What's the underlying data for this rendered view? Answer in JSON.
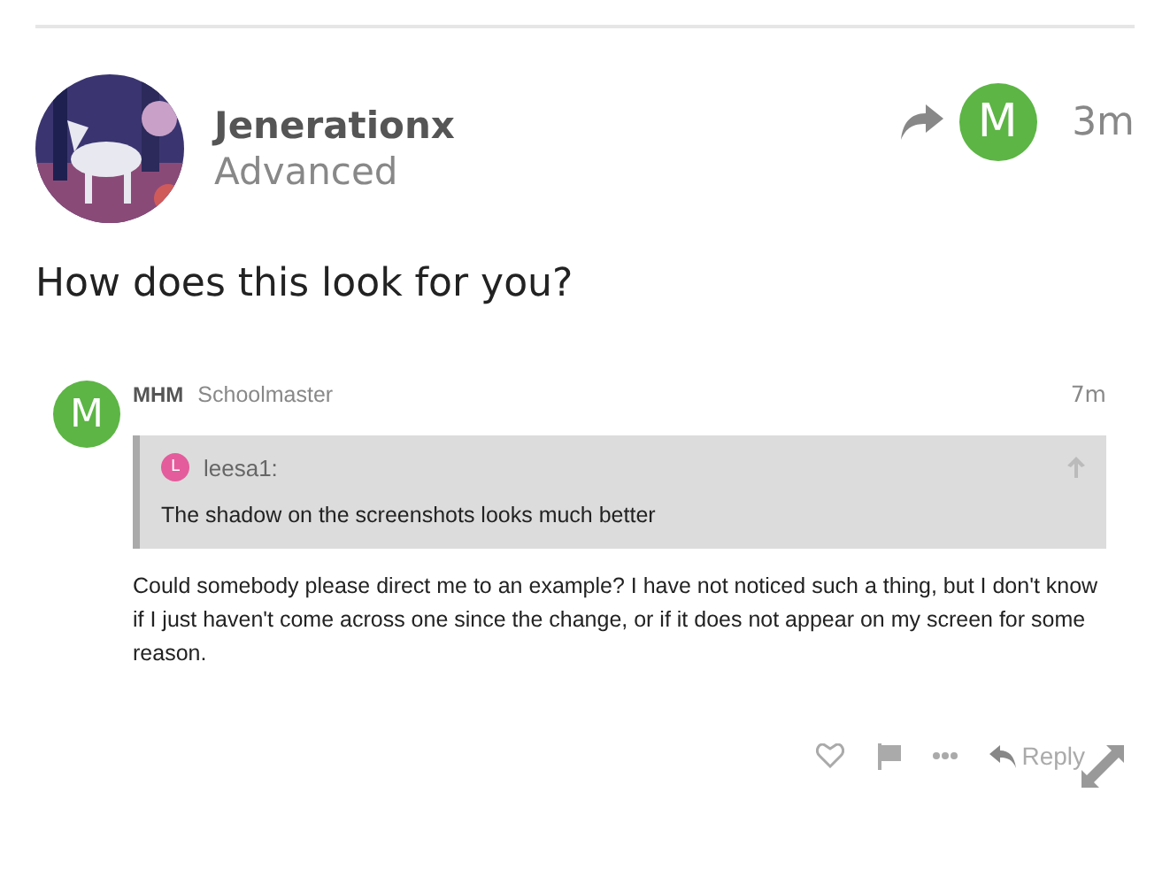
{
  "post": {
    "author": "Jenerationx",
    "title": "Advanced",
    "reply_to_avatar": {
      "letter": "M",
      "color": "#5cb544"
    },
    "time": "3m",
    "body": "How does this look for you?"
  },
  "embedded": {
    "avatar": {
      "letter": "M",
      "color": "#5cb544"
    },
    "author": "MHM",
    "title": "Schoolmaster",
    "time": "7m",
    "quote": {
      "avatar": {
        "letter": "L",
        "color": "#e45c9c"
      },
      "author": "leesa1:",
      "text": "The shadow on the screenshots looks much better"
    },
    "body": "Could somebody please direct me to an example? I have not noticed such a thing, but I don't know if I just haven't come across one since the change, or if it does not appear on my screen for some reason.",
    "reply_label": "Reply"
  }
}
